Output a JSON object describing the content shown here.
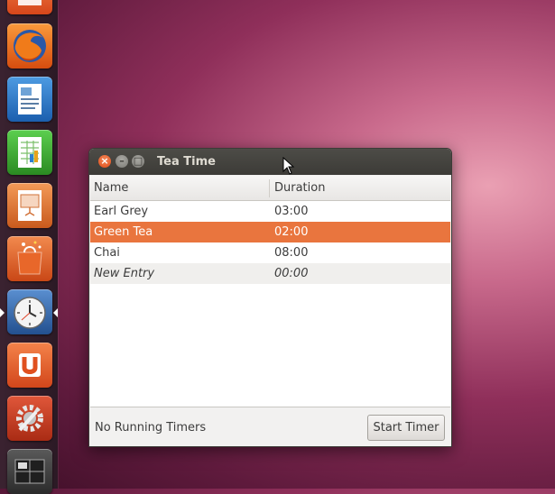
{
  "launcher": {
    "items": [
      {
        "name": "partial-app",
        "color": "#e95e2a"
      },
      {
        "name": "firefox",
        "color": "#e66000"
      },
      {
        "name": "libreoffice-writer",
        "color": "#2a6fb5"
      },
      {
        "name": "libreoffice-calc",
        "color": "#3ea032"
      },
      {
        "name": "libreoffice-impress",
        "color": "#d86a2b"
      },
      {
        "name": "software-center",
        "color": "#e25b21"
      },
      {
        "name": "tea-time",
        "color": "#2f6ab0",
        "active": true
      },
      {
        "name": "ubuntu-one",
        "color": "#e85b22"
      },
      {
        "name": "system-settings",
        "color": "#c33a1a"
      },
      {
        "name": "workspace-switcher",
        "color": "#3a3a3a"
      }
    ]
  },
  "window": {
    "title": "Tea Time",
    "columns": {
      "name": "Name",
      "duration": "Duration"
    },
    "rows": [
      {
        "name": "Earl Grey",
        "duration": "03:00"
      },
      {
        "name": "Green Tea",
        "duration": "02:00",
        "selected": true
      },
      {
        "name": "Chai",
        "duration": "08:00"
      },
      {
        "name": "New Entry",
        "duration": "00:00",
        "placeholder": true
      }
    ],
    "status": "No Running Timers",
    "start_button": "Start Timer",
    "selection_color": "#e9753e"
  }
}
